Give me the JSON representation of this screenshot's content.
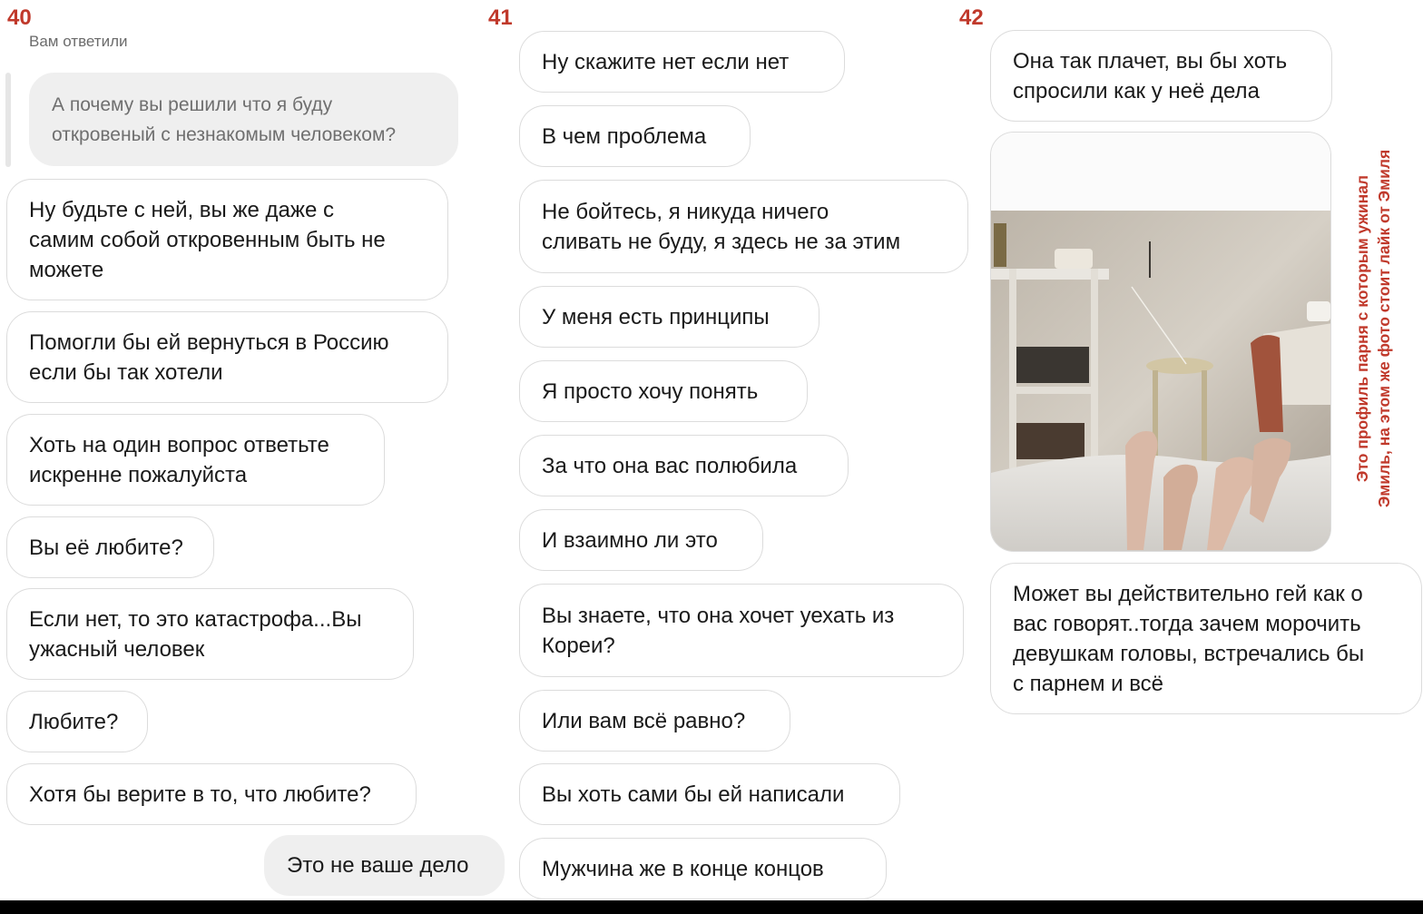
{
  "page_numbers": [
    "40",
    "41",
    "42"
  ],
  "column1": {
    "replied_label": "Вам ответили",
    "quoted_message": [
      "А почему вы решили что я буду",
      "откровеный с незнакомым человеком?"
    ],
    "messages": [
      [
        "Ну будьте с ней, вы же даже с",
        "самим собой откровенным быть не",
        "можете"
      ],
      [
        "Помогли бы ей вернуться в Россию",
        "если бы так хотели"
      ],
      [
        "Хоть на один вопрос ответьте",
        "искренне пожалуйста"
      ],
      [
        "Вы её любите?"
      ],
      [
        "Если нет, то это катастрофа...Вы",
        "ужасный человек"
      ],
      [
        "Любите?"
      ],
      [
        "Хотя бы верите в то, что любите?"
      ]
    ],
    "own_reply": "Это не ваше дело"
  },
  "column2": {
    "messages": [
      [
        "Ну скажите нет если нет"
      ],
      [
        "В чем проблема"
      ],
      [
        "Не бойтесь, я никуда ничего",
        "сливать не буду, я здесь не за этим"
      ],
      [
        "У меня есть принципы"
      ],
      [
        "Я просто хочу понять"
      ],
      [
        "За что она вас полюбила"
      ],
      [
        "И взаимно ли это"
      ],
      [
        "Вы знаете, что она хочет уехать из",
        "Кореи?"
      ],
      [
        "Или вам всё равно?"
      ],
      [
        "Вы хоть сами бы ей написали"
      ],
      [
        "Мужчина же в конце концов"
      ]
    ]
  },
  "column3": {
    "messages_top": [
      [
        "Она так плачет, вы бы хоть",
        "спросили как у неё дела"
      ]
    ],
    "messages_bottom": [
      [
        "Может вы действительно гей как о",
        "вас говорят..тогда зачем морочить",
        "девушкам головы, встречались бы",
        "с парнем и всё"
      ]
    ],
    "side_note": [
      "Это профиль парня с которым ужинал",
      "Эмиль, на этом же фото стоит лайк от Эмиля"
    ]
  },
  "colors": {
    "accent_red": "#c0392b",
    "bubble_border": "#dcdcdc",
    "bubble_fill_gray": "#efefef"
  }
}
